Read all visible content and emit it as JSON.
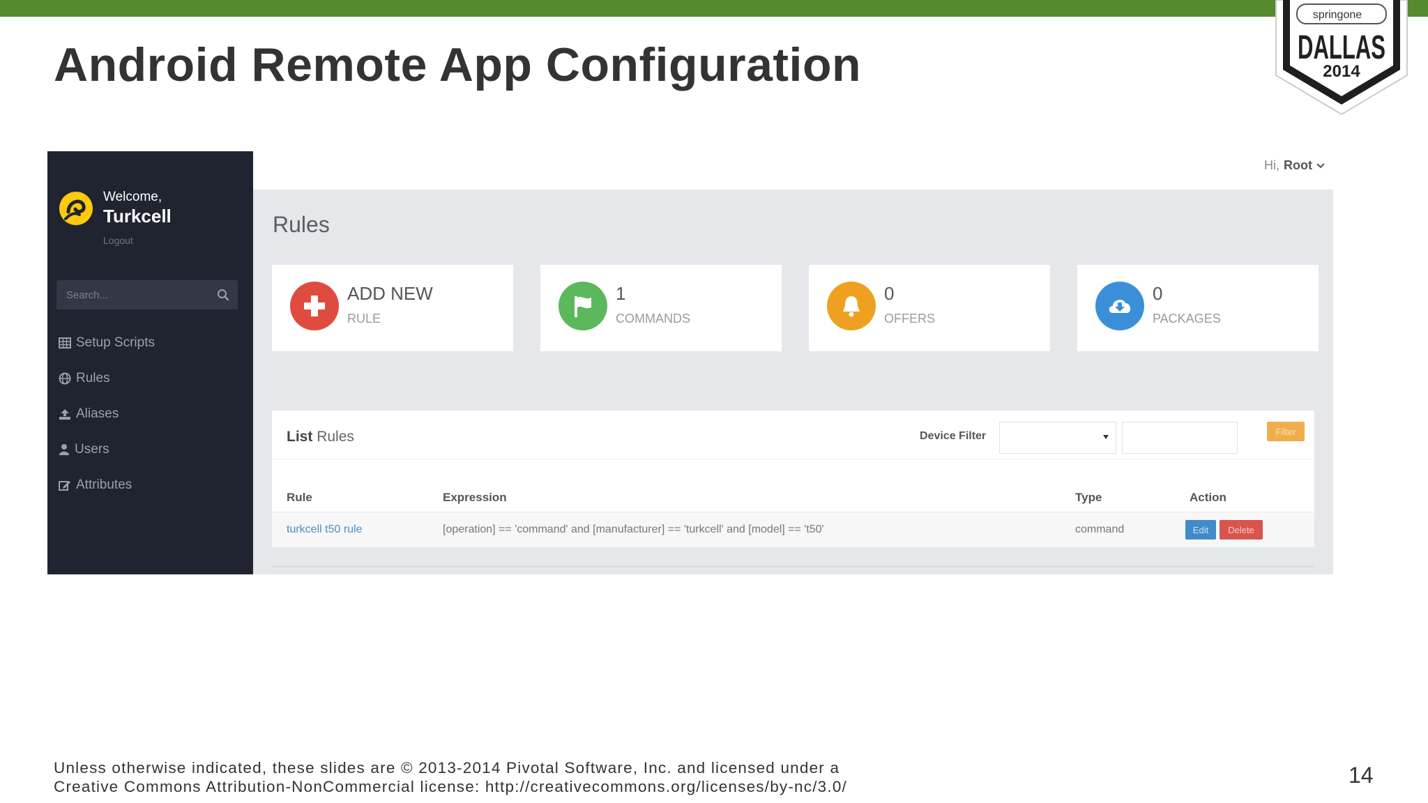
{
  "slide": {
    "title": "Android Remote App Configuration",
    "footer_line1": "Unless otherwise indicated, these slides are © 2013-2014 Pivotal Software, Inc. and licensed under a",
    "footer_line2": "Creative Commons Attribution-NonCommercial license: http://creativecommons.org/licenses/by-nc/3.0/",
    "page_number": "14",
    "accent_color": "#568a2e",
    "badge": {
      "top_text": "springone",
      "city": "DALLAS",
      "year": "2014"
    }
  },
  "app": {
    "sidebar": {
      "welcome": "Welcome,",
      "brand": "Turkcell",
      "logout": "Logout",
      "search_placeholder": "Search...",
      "items": [
        {
          "label": "Setup Scripts",
          "icon": "table-icon"
        },
        {
          "label": "Rules",
          "icon": "globe-icon"
        },
        {
          "label": "Aliases",
          "icon": "upload-icon"
        },
        {
          "label": "Users",
          "icon": "user-icon"
        },
        {
          "label": "Attributes",
          "icon": "edit-icon"
        }
      ]
    },
    "header": {
      "greeting": "Hi,",
      "user": "Root"
    },
    "page_title": "Rules",
    "stats": [
      {
        "value": "ADD NEW",
        "label": "RULE",
        "icon": "plus-icon",
        "color": "#e04b3f"
      },
      {
        "value": "1",
        "label": "COMMANDS",
        "icon": "flag-icon",
        "color": "#5cb85c"
      },
      {
        "value": "0",
        "label": "OFFERS",
        "icon": "bell-icon",
        "color": "#f0a020"
      },
      {
        "value": "0",
        "label": "PACKAGES",
        "icon": "cloud-download-icon",
        "color": "#3a8fd8"
      }
    ],
    "list": {
      "title_bold": "List",
      "title_rest": "Rules",
      "filter_label": "Device Filter",
      "filter_button": "Filter",
      "columns": [
        "Rule",
        "Expression",
        "Type",
        "Action"
      ],
      "rows": [
        {
          "rule": "turkcell t50 rule",
          "expression": "[operation] == 'command' and [manufacturer] == 'turkcell' and [model] == 't50'",
          "type": "command",
          "edit": "Edit",
          "delete": "Delete"
        }
      ]
    }
  }
}
